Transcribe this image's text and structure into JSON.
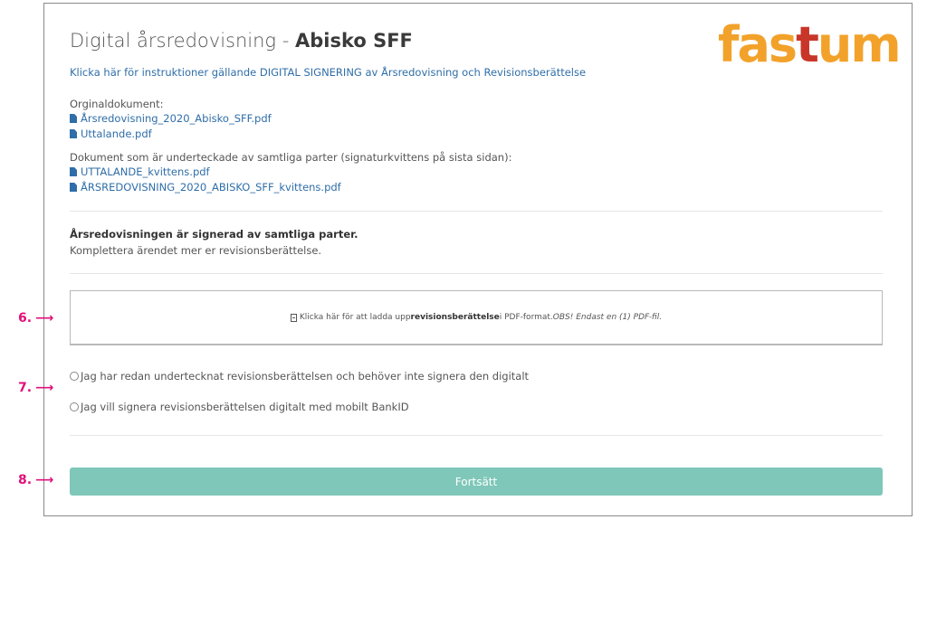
{
  "page": {
    "title_prefix": "Digital årsredovisning - ",
    "title_company": "Abisko SFF",
    "logo_text_a": "fas",
    "logo_text_cross": "t",
    "logo_text_b": "um",
    "instructions_link": "Klicka här för instruktioner gällande DIGITAL SIGNERING av Årsredovisning och Revisionsberättelse"
  },
  "original_docs": {
    "label": "Orginaldokument:",
    "files": [
      "Årsredovisning_2020_Abisko_SFF.pdf",
      "Uttalande.pdf"
    ]
  },
  "signed_docs": {
    "label": "Dokument som är underteckade av samtliga parter (signaturkvittens på sista sidan):",
    "files": [
      "UTTALANDE_kvittens.pdf",
      "ÅRSREDOVISNING_2020_ABISKO_SFF_kvittens.pdf"
    ]
  },
  "status": {
    "bold": "Årsredovisningen är signerad av samtliga parter.",
    "text": "Komplettera ärendet mer er revisionsberättelse."
  },
  "upload": {
    "pre": "Klicka här för att ladda upp ",
    "bold": "revisionsberättelse",
    "mid": " i PDF-format. ",
    "italic": "OBS! Endast en (1) PDF-fil."
  },
  "options": [
    "Jag har redan undertecknat revisionsberättelsen och behöver inte signera den digitalt",
    "Jag vill signera revisionsberättelsen digitalt med mobilt BankID"
  ],
  "continue_label": "Fortsätt",
  "markers": {
    "six": "6.",
    "seven": "7.",
    "eight": "8.",
    "arrow": "⟶"
  },
  "colors": {
    "link": "#2f6ea8",
    "button": "#7ec7b9",
    "logo": "#f2a22a",
    "marker": "#e0107a"
  }
}
